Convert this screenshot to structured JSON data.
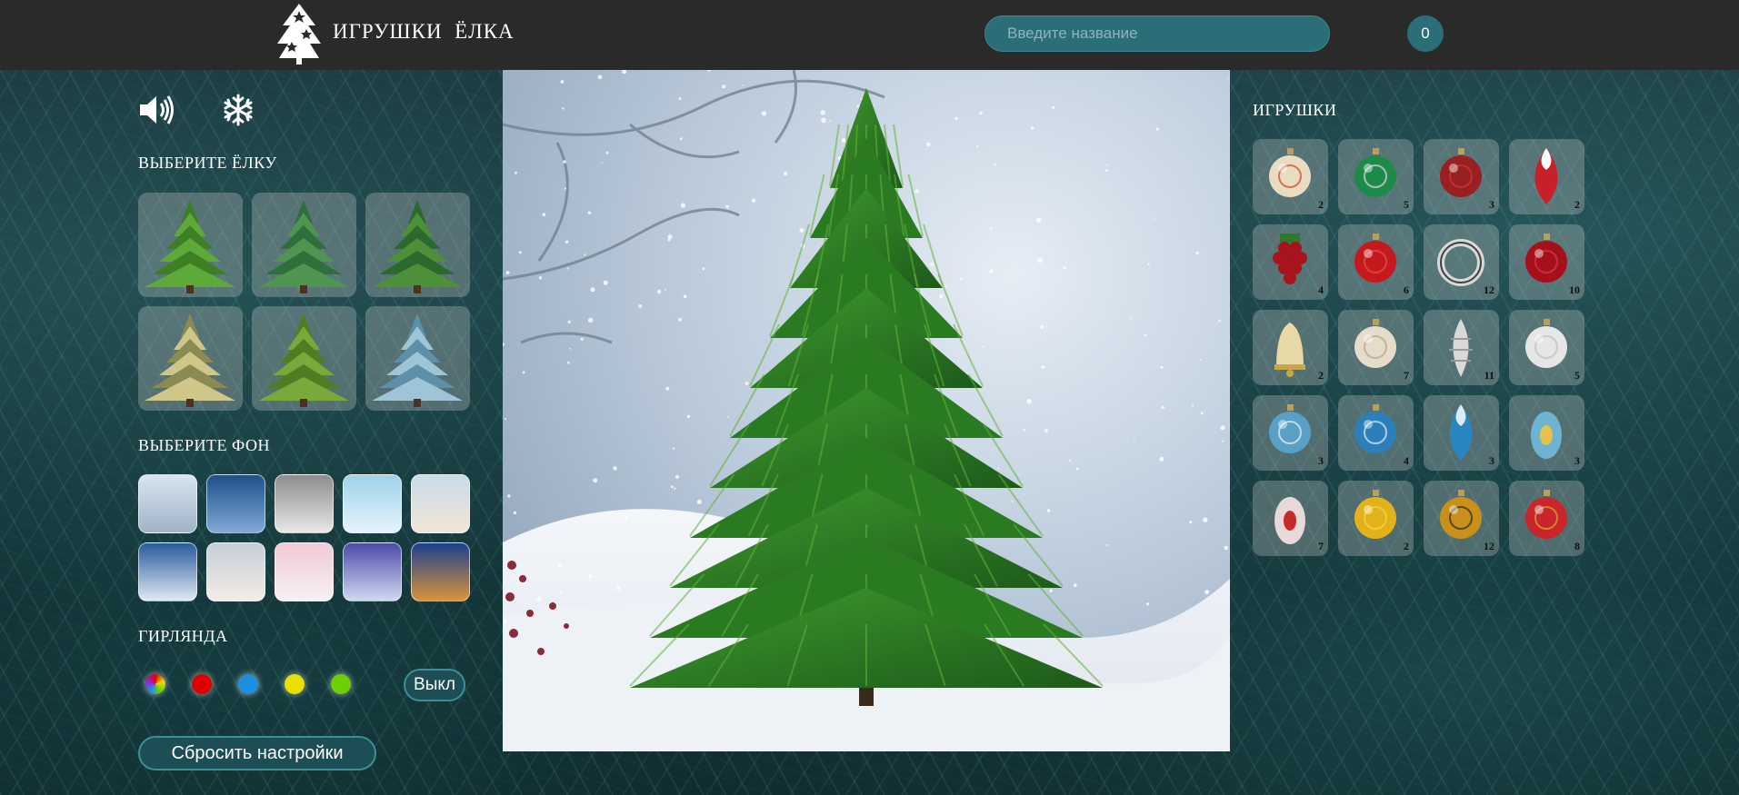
{
  "header": {
    "title": "ИГРУШКИ  ЁЛКА",
    "search_placeholder": "Введите название",
    "selected_count": "0"
  },
  "left": {
    "controls": [
      "sound-icon",
      "snowflake-icon"
    ],
    "tree_section_title": "ВЫБЕРИТЕ ЁЛКУ",
    "trees": [
      {
        "color": "#3f7f24",
        "tip": "#5fa83a"
      },
      {
        "color": "#2e6f3a",
        "tip": "#4f9450"
      },
      {
        "color": "#2b6a2c",
        "tip": "#4e8f3a"
      },
      {
        "color": "#8a8a55",
        "tip": "#cfc68a"
      },
      {
        "color": "#4f7e22",
        "tip": "#7aa83a"
      },
      {
        "color": "#5e8fa8",
        "tip": "#9fc4d6"
      }
    ],
    "bg_section_title": "ВЫБЕРИТЕ ФОН",
    "backgrounds": [
      {
        "top": "#d9e4ee",
        "bottom": "#9fb4c9"
      },
      {
        "top": "#1f4f8a",
        "bottom": "#7fa9d6"
      },
      {
        "top": "#8c8c8c",
        "bottom": "#e8e8e8"
      },
      {
        "top": "#9fd1ea",
        "bottom": "#e6f4fb"
      },
      {
        "top": "#c9dbe9",
        "bottom": "#f0e6d8"
      },
      {
        "top": "#2a5a9c",
        "bottom": "#dfe9f4"
      },
      {
        "top": "#c6cfd9",
        "bottom": "#f3ece6"
      },
      {
        "top": "#f2c9d6",
        "bottom": "#f6f1f3"
      },
      {
        "top": "#4d4aa8",
        "bottom": "#cfd8f0"
      },
      {
        "top": "#1d3f8f",
        "bottom": "#d9933d"
      }
    ],
    "garland_section_title": "ГИРЛЯНДА",
    "garland_colors": [
      "multicolor",
      "#e00000",
      "#1e8fe0",
      "#e8e000",
      "#6ed000"
    ],
    "garland_toggle_label": "Выкл",
    "reset_label": "Сбросить настройки"
  },
  "right": {
    "toys_title": "ИГРУШКИ",
    "toys": [
      {
        "count": "2",
        "kind": "ball",
        "color": "#e9dcc0",
        "accent": "#c8462a"
      },
      {
        "count": "5",
        "kind": "ball",
        "color": "#1e8a4a",
        "accent": "#d8d8d8"
      },
      {
        "count": "3",
        "kind": "ball",
        "color": "#9a1f22",
        "accent": "#c73a3a"
      },
      {
        "count": "2",
        "kind": "drop",
        "color": "#c8202a",
        "accent": "#ffffff"
      },
      {
        "count": "4",
        "kind": "grapes",
        "color": "#a8141e",
        "accent": "#2f7a2a"
      },
      {
        "count": "6",
        "kind": "ball",
        "color": "#c41a1e",
        "accent": "#e85050"
      },
      {
        "count": "12",
        "kind": "ring",
        "color": "#d9d9d9",
        "accent": "#444444"
      },
      {
        "count": "10",
        "kind": "ball",
        "color": "#a5101c",
        "accent": "#d83a4a"
      },
      {
        "count": "2",
        "kind": "bell",
        "color": "#e8d9a8",
        "accent": "#c9a64a"
      },
      {
        "count": "7",
        "kind": "ball",
        "color": "#e6dccb",
        "accent": "#b9a27a"
      },
      {
        "count": "11",
        "kind": "cone",
        "color": "#d9d9d9",
        "accent": "#9a9a9a"
      },
      {
        "count": "5",
        "kind": "ball",
        "color": "#e6e6e6",
        "accent": "#bdbdbd"
      },
      {
        "count": "3",
        "kind": "ball",
        "color": "#5a9fc4",
        "accent": "#e8f2f8"
      },
      {
        "count": "4",
        "kind": "ball",
        "color": "#2c7fb8",
        "accent": "#dcecf6"
      },
      {
        "count": "3",
        "kind": "drop",
        "color": "#2a86bf",
        "accent": "#dcecf6"
      },
      {
        "count": "3",
        "kind": "egg",
        "color": "#6fb3d3",
        "accent": "#e6c24a"
      },
      {
        "count": "7",
        "kind": "egg",
        "color": "#e8d8d8",
        "accent": "#c42a2a"
      },
      {
        "count": "2",
        "kind": "ball",
        "color": "#e3b21a",
        "accent": "#f4d64a"
      },
      {
        "count": "12",
        "kind": "ball",
        "color": "#c9901a",
        "accent": "#2a2a2a"
      },
      {
        "count": "8",
        "kind": "ball",
        "color": "#c8262a",
        "accent": "#d8a73a"
      }
    ]
  }
}
